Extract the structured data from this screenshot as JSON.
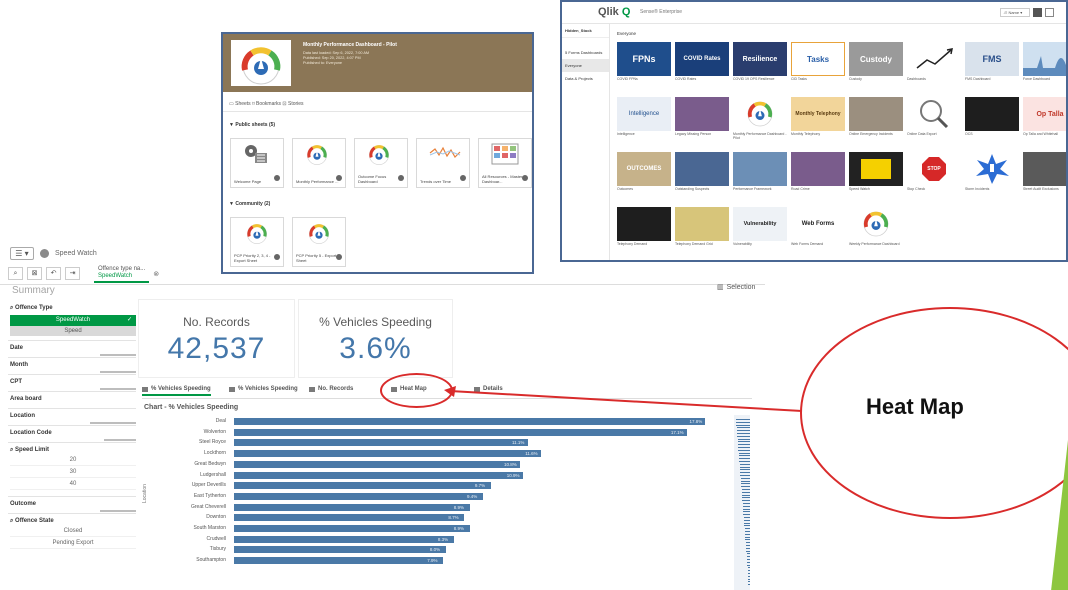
{
  "main": {
    "menu_glyph": "☰ ▾",
    "app_name": "Speed Watch",
    "toolbar_tag_line1": "Offence type na...",
    "toolbar_tag_line2": "SpeedWatch",
    "selections_label": "Selection",
    "page_title": "Summary"
  },
  "filters": {
    "offence_type": {
      "label": "Offence Type",
      "selected": "SpeedWatch",
      "other": "Speed"
    },
    "fields": [
      "Date",
      "Month",
      "CPT",
      "Area board",
      "Location",
      "Location Code"
    ],
    "speed_limit": {
      "label": "Speed Limit",
      "values": [
        "20",
        "30",
        "40"
      ]
    },
    "outcome": "Outcome",
    "offence_state": {
      "label": "Offence State",
      "values": [
        "Closed",
        "Pending Export"
      ]
    }
  },
  "kpis": [
    {
      "title": "No. Records",
      "value": "42,537"
    },
    {
      "title": "% Vehicles Speeding",
      "value": "3.6%"
    }
  ],
  "tabs": [
    "% Vehicles Speeding",
    "% Vehicles Speeding",
    "No. Records",
    "Heat Map",
    "Details"
  ],
  "chart": {
    "title": "Chart - % Vehicles Speeding",
    "axis_label": "Location"
  },
  "chart_data": {
    "type": "bar",
    "orientation": "horizontal",
    "title": "Chart - % Vehicles Speeding",
    "ylabel": "Location",
    "categories": [
      "Deal",
      "Wolverton",
      "Steel Royce",
      "Lockthorn",
      "Great Bedwyn",
      "Ludgershall",
      "Upper Deverills",
      "East Tytherton",
      "Great Cheverell",
      "Downton",
      "South Marston",
      "Crudwell",
      "Tisbury",
      "Southampton"
    ],
    "values": [
      17.8,
      17.1,
      11.1,
      11.6,
      10.8,
      10.9,
      9.7,
      9.4,
      8.9,
      8.7,
      8.9,
      8.3,
      8.0,
      7.9
    ],
    "data_labels": [
      "17.8%",
      "17.1%",
      "11.1%",
      "11.6%",
      "10.8%",
      "10.9%",
      "9.7%",
      "9.4%",
      "8.9%",
      "8.7%",
      "8.9%",
      "8.3%",
      "8.0%",
      "7.9%"
    ],
    "xlim": [
      0,
      18.5
    ]
  },
  "dash_shot": {
    "title": "Monthly Performance Dashboard - Pilot",
    "lines": [
      "Data last loaded: Sep 6, 2022, 7:00 AM",
      "Published: Sep 20, 2022, 4:07 PM",
      "Published to: Everyone"
    ],
    "tabs": "▭ Sheets   ⌑ Bookmarks   ⊡ Stories",
    "public_header": "▼ Public sheets (5)",
    "community_header": "▼ Community (2)",
    "public_sheets": [
      "Welcome Page",
      "Monthly Performance ...",
      "Outcome Focus Dashboard",
      "Trends over Time",
      "All Resources - Master Dashboar..."
    ],
    "community_sheets": [
      "PCP Priority 2, 3, 4 - Export Sheet",
      "PCP Priority 5 - Export Sheet"
    ]
  },
  "hub": {
    "logo_text": "Qlik",
    "logo_q": "Q",
    "product": "Sense® Enterprise",
    "side_items": [
      "Hidden_Stock",
      "",
      "5 Forms Dashboards",
      "Everyone",
      "Data & Projects"
    ],
    "crumb": "Everyone",
    "tiles": [
      {
        "img": "FPNs",
        "cap": "COVID FPNs"
      },
      {
        "img": "COVID Rates",
        "cap": "COVID Rates"
      },
      {
        "img": "Resilience",
        "cap": "COVID 19 OPS Resilience"
      },
      {
        "img": "Tasks",
        "cap": "CID Tasks"
      },
      {
        "img": "Custody",
        "cap": "Custody"
      },
      {
        "img": "",
        "cap": "Dashboards"
      },
      {
        "img": "FMS",
        "cap": "FMS Dashboard"
      },
      {
        "img": "",
        "cap": "Force Dashboard"
      },
      {
        "img": "Intelligence",
        "cap": "Intelligence"
      },
      {
        "img": "",
        "cap": "Legacy Missing Person"
      },
      {
        "img": "",
        "cap": "Monthly Performance Dashboard - Pilot"
      },
      {
        "img": "Monthly Telephony",
        "cap": "Monthly Telephony"
      },
      {
        "img": "",
        "cap": "Online Emergency Incidents"
      },
      {
        "img": "",
        "cap": "Online Data Export"
      },
      {
        "img": "",
        "cap": "OCS"
      },
      {
        "img": "Op Talla",
        "cap": "Op Talla and Whitehall"
      },
      {
        "img": "OUTCOMES",
        "cap": "Outcomes"
      },
      {
        "img": "",
        "cap": "Outstanding Suspects"
      },
      {
        "img": "",
        "cap": "Performance Framework"
      },
      {
        "img": "",
        "cap": "Road Crime"
      },
      {
        "img": "",
        "cap": "Speed Watch"
      },
      {
        "img": "STOP",
        "cap": "Stop Check"
      },
      {
        "img": "",
        "cap": "Storm Incidents"
      },
      {
        "img": "",
        "cap": "Street Audit Exclusions"
      },
      {
        "img": "",
        "cap": "Telephony Demand"
      },
      {
        "img": "",
        "cap": "Telephony Demand Grid"
      },
      {
        "img": "Vulnerability",
        "cap": "Vulnerability"
      },
      {
        "img": "Web Forms",
        "cap": "Web Forms Demand"
      },
      {
        "img": "",
        "cap": "Weekly Performance Dashboard"
      }
    ]
  },
  "callout": {
    "text": "Heat Map"
  },
  "colors": {
    "qlik_green": "#009845",
    "bar_blue": "#4a79a7",
    "kpi_blue": "#4477aa",
    "callout_red": "#d92b2b",
    "frame_blue": "#4a6793"
  }
}
